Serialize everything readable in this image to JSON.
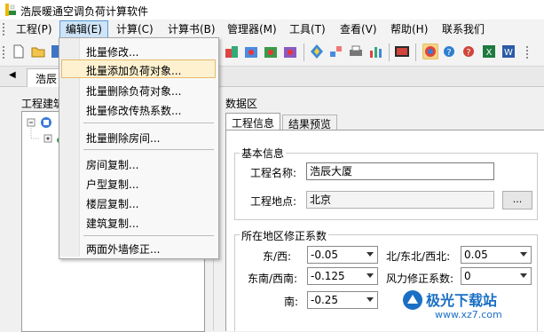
{
  "app": {
    "title": "浩辰暖通空调负荷计算软件"
  },
  "menubar": {
    "items": [
      "工程(P)",
      "编辑(E)",
      "计算(C)",
      "计算书(B)",
      "管理器(M)",
      "工具(T)",
      "查看(V)",
      "帮助(H)",
      "联系我们"
    ]
  },
  "doc_tab": {
    "label": "浩辰"
  },
  "left_pane": {
    "title": "工程建筑"
  },
  "right_pane": {
    "title": "数据区",
    "tabs": [
      "工程信息",
      "结果预览"
    ],
    "basic_info": {
      "legend": "基本信息",
      "name_label": "工程名称:",
      "name_value": "浩辰大厦",
      "location_label": "工程地点:",
      "location_value": "北京",
      "browse_label": "..."
    },
    "correction": {
      "legend": "所在地区修正系数",
      "ew_label": "东/西:",
      "ew_value": "-0.05",
      "nne_label": "北/东北/西北:",
      "nne_value": "0.05",
      "sesw_label": "东南/西南:",
      "sesw_value": "-0.125",
      "wind_label": "风力修正系数:",
      "wind_value": "0",
      "s_label": "南:",
      "s_value": "-0.25"
    }
  },
  "edit_menu": {
    "items": [
      "批量修改...",
      "批量添加负荷对象...",
      "批量删除负荷对象...",
      "批量修改传热系数...",
      "批量删除房间...",
      "房间复制...",
      "户型复制...",
      "楼层复制...",
      "建筑复制...",
      "两面外墙修正..."
    ],
    "highlighted_index": 1
  },
  "watermark": {
    "brand": "极光下载站",
    "url": "www.xz7.com"
  },
  "colors": {
    "menu_highlight": "#fdf1d0",
    "menu_active": "#cfe4f7",
    "brand_blue": "#1a6fc4"
  }
}
